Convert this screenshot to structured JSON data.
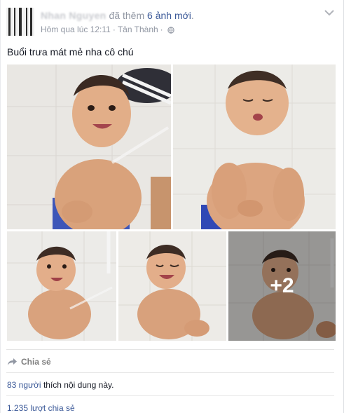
{
  "post": {
    "author": "Nhan Nguyen",
    "action_prefix": "đã thêm",
    "action_link": "6 ảnh mới",
    "action_suffix": ".",
    "timestamp": "Hôm qua lúc 12:11",
    "separator": "·",
    "location": "Tân Thành",
    "separator2": "·",
    "text": "Buổi trưa mát mẻ nha cô chú"
  },
  "photos": {
    "more_count": "+2"
  },
  "actions": {
    "share_label": "Chia sẻ"
  },
  "stats": {
    "likes_count": "83 người",
    "likes_suffix": " thích nội dung này.",
    "shares_text": "1.235 lượt chia sẻ"
  },
  "icons": {
    "globe": "globe-icon",
    "chevron": "chevron-down-icon",
    "share": "share-arrow-icon"
  },
  "colors": {
    "link": "#3b5998",
    "meta": "#9197a3",
    "text": "#141823"
  }
}
